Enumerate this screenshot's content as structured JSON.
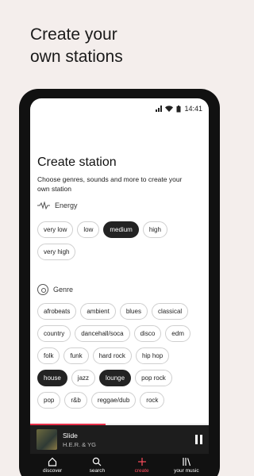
{
  "promo": {
    "line1": "Create your",
    "line2": "own stations"
  },
  "status": {
    "time": "14:41"
  },
  "page": {
    "title": "Create station",
    "subtitle": "Choose genres, sounds and more to create your own station"
  },
  "energy": {
    "label": "Energy",
    "chips": [
      [
        {
          "label": "very low",
          "selected": false
        },
        {
          "label": "low",
          "selected": false
        },
        {
          "label": "medium",
          "selected": true
        },
        {
          "label": "high",
          "selected": false
        }
      ],
      [
        {
          "label": "very high",
          "selected": false
        }
      ]
    ]
  },
  "genre": {
    "label": "Genre",
    "chips": [
      [
        {
          "label": "afrobeats",
          "selected": false
        },
        {
          "label": "ambient",
          "selected": false
        },
        {
          "label": "blues",
          "selected": false
        },
        {
          "label": "classical",
          "selected": false
        }
      ],
      [
        {
          "label": "country",
          "selected": false
        },
        {
          "label": "dancehall/soca",
          "selected": false
        },
        {
          "label": "disco",
          "selected": false
        },
        {
          "label": "edm",
          "selected": false
        }
      ],
      [
        {
          "label": "folk",
          "selected": false
        },
        {
          "label": "funk",
          "selected": false
        },
        {
          "label": "hard rock",
          "selected": false
        },
        {
          "label": "hip hop",
          "selected": false
        }
      ],
      [
        {
          "label": "house",
          "selected": true
        },
        {
          "label": "jazz",
          "selected": false
        },
        {
          "label": "lounge",
          "selected": true
        },
        {
          "label": "pop rock",
          "selected": false
        }
      ],
      [
        {
          "label": "pop",
          "selected": false
        },
        {
          "label": "r&b",
          "selected": false
        },
        {
          "label": "reggae/dub",
          "selected": false
        },
        {
          "label": "rock",
          "selected": false
        }
      ]
    ]
  },
  "player": {
    "song": "Slide",
    "artist": "H.E.R. & YG",
    "progress": 0.42,
    "accent": "#e8304a"
  },
  "nav": {
    "items": [
      {
        "label": "discover",
        "icon": "home-icon",
        "active": false
      },
      {
        "label": "search",
        "icon": "search-icon",
        "active": false
      },
      {
        "label": "create",
        "icon": "plus-icon",
        "active": true
      },
      {
        "label": "your music",
        "icon": "library-icon",
        "active": false
      }
    ]
  }
}
